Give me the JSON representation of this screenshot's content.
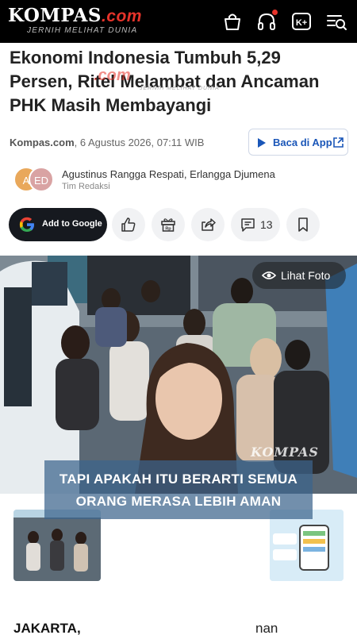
{
  "header": {
    "logo_text": "KOMPAS",
    "logo_suffix": ".com",
    "tagline": "JERNIH MELIHAT DUNIA",
    "icons": [
      "bag-icon",
      "headphones-icon",
      "kplus-icon",
      "menu-search-icon"
    ],
    "accent": "#e6332a"
  },
  "article": {
    "title": "Ekonomi Indonesia Tumbuh 5,29 Persen, Ritel Melambat dan Ancaman PHK Masih Membayangi",
    "watermark": ".com",
    "watermark_sub": "JERNIH MELIHAT DUNIA",
    "source": "Kompas.com",
    "date": ", 6 Agustus 2026, 07:11 WIB",
    "app_button": "Baca di App",
    "authors": "Agustinus Rangga Respati,  Erlangga Djumena",
    "team": "Tim Redaksi",
    "avatar_1": "A",
    "avatar_2": "ED"
  },
  "actions": {
    "google_label": "Add to Google",
    "comment_count": "13"
  },
  "photo": {
    "view_label": "Lihat Foto",
    "watermark": "KOMPAS"
  },
  "caption": {
    "line1": "TAPI APAKAH ITU BERARTI SEMUA",
    "line2": "ORANG MERASA LEBIH AMAN"
  },
  "body": {
    "dateline": "JAKARTA,",
    "trailing": "nan"
  }
}
